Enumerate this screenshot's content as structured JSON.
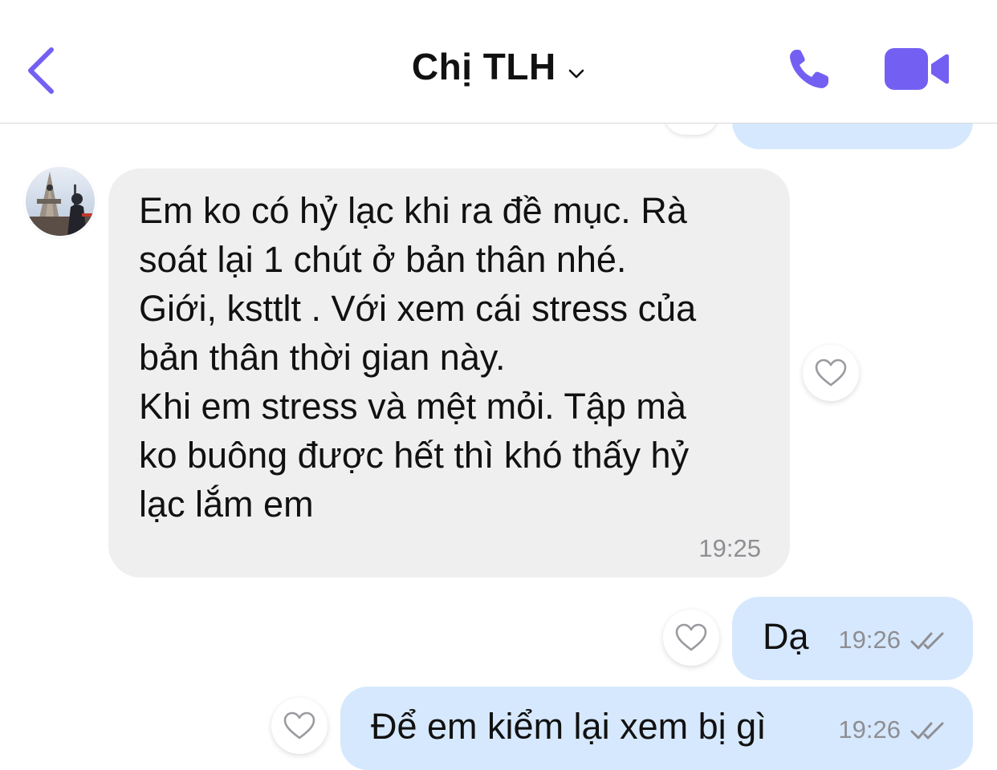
{
  "header": {
    "title": "Chị TLH",
    "back_icon": "chevron-left-icon",
    "call_icon": "phone-icon",
    "video_icon": "video-camera-icon",
    "accent_color": "#7360f2"
  },
  "messages": [
    {
      "direction": "incoming",
      "text": "Em ko có hỷ lạc khi ra đề mục. Rà\nsoát lại 1 chút ở bản thân nhé.\nGiới, ksttlt . Với xem cái stress của\nbản thân thời gian này.\nKhi em stress và mệt mỏi. Tập mà\nko buông được hết thì khó thấy hỷ\nlạc lắm em",
      "time": "19:25"
    },
    {
      "direction": "outgoing",
      "text": "Dạ",
      "time": "19:26",
      "status_icon": "double-check-icon"
    },
    {
      "direction": "outgoing",
      "text": "Để em kiểm lại xem bị gì",
      "time": "19:26",
      "status_icon": "double-check-icon"
    }
  ],
  "colors": {
    "incoming_bubble": "#efefef",
    "outgoing_bubble": "#d6e8fd",
    "timestamp": "#8e8e93"
  }
}
